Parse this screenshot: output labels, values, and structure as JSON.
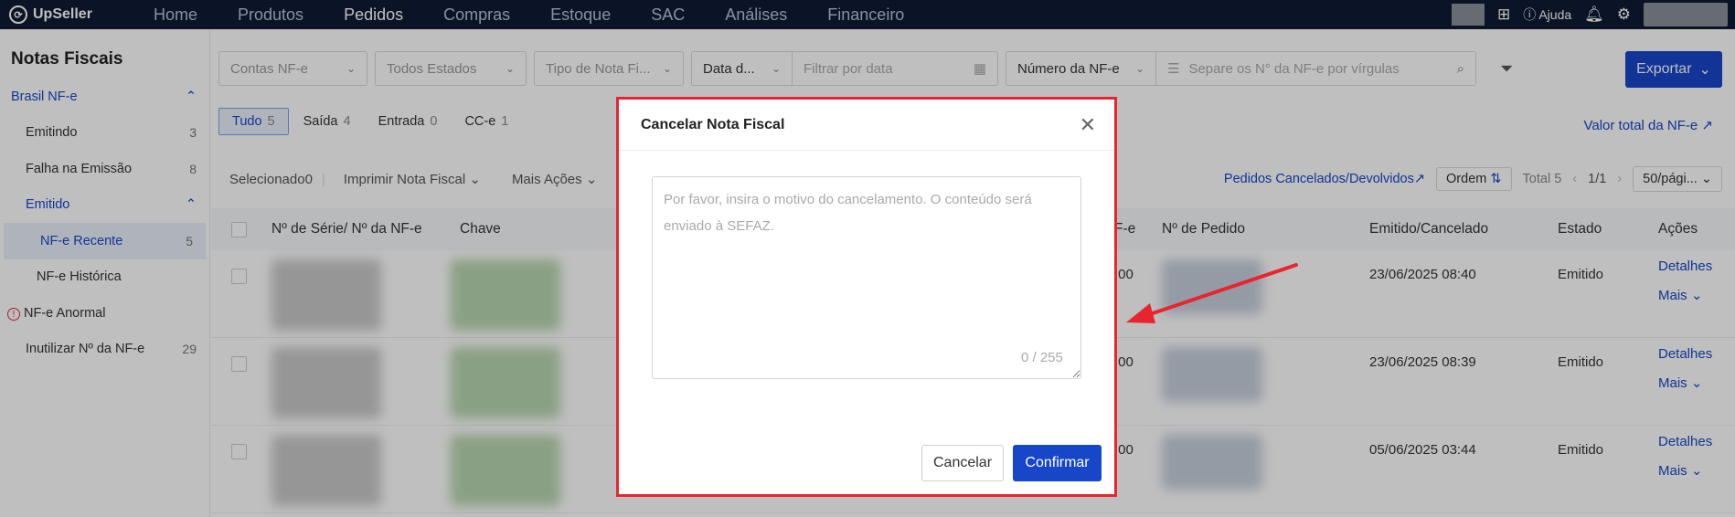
{
  "brand": {
    "name": "UpSeller"
  },
  "nav": [
    "Home",
    "Produtos",
    "Pedidos",
    "Compras",
    "Estoque",
    "SAC",
    "Análises",
    "Financeiro"
  ],
  "nav_active": "Pedidos",
  "top_right": {
    "help": "Ajuda"
  },
  "sidebar": {
    "title": "Notas Fiscais",
    "group": "Brasil NF-e",
    "items": [
      {
        "label": "Emitindo",
        "count": "3"
      },
      {
        "label": "Falha na Emissão",
        "count": "8"
      }
    ],
    "emitido": "Emitido",
    "emitido_children": [
      {
        "label": "NF-e Recente",
        "count": "5"
      },
      {
        "label": "NF-e Histórica",
        "count": ""
      }
    ],
    "abnormal": "NF-e Anormal",
    "inutilizar": {
      "label": "Inutilizar Nº da NF-e",
      "count": "29"
    }
  },
  "filters": {
    "contas": "Contas NF-e",
    "estados": "Todos Estados",
    "tipo": "Tipo de Nota Fi...",
    "data_sel": "Data d...",
    "data_placeholder": "Filtrar por data",
    "numero_sel": "Número da NF-e",
    "numero_placeholder": "Separe os N° da NF-e por vírgulas"
  },
  "export_label": "Exportar",
  "tabs": [
    {
      "label": "Tudo",
      "count": "5"
    },
    {
      "label": "Saída",
      "count": "4"
    },
    {
      "label": "Entrada",
      "count": "0"
    },
    {
      "label": "CC-e",
      "count": "1"
    }
  ],
  "valor_total": "Valor total da NF-e",
  "toolbar": {
    "selecionado": "Selecionado",
    "selecionado_count": "0",
    "imprimir": "Imprimir Nota Fiscal",
    "mais_acoes": "Mais Ações",
    "cancelados": "Pedidos Cancelados/Devolvidos",
    "ordem": "Ordem",
    "total": "Total 5",
    "page": "1/1",
    "per_page": "50/pági..."
  },
  "table": {
    "headers": {
      "serie": "Nº de Série/ Nº da NF-e",
      "chave": "Chave",
      "valor_partial": "F-e",
      "pedido": "Nº de Pedido",
      "emitido": "Emitido/Cancelado",
      "estado": "Estado",
      "acoes": "Ações"
    },
    "rows": [
      {
        "valor_partial": ",00",
        "date": "23/06/2025 08:40",
        "estado": "Emitido",
        "detalhes": "Detalhes",
        "mais": "Mais"
      },
      {
        "valor_partial": ",00",
        "date": "23/06/2025 08:39",
        "estado": "Emitido",
        "detalhes": "Detalhes",
        "mais": "Mais"
      },
      {
        "valor_partial": ",00",
        "date": "05/06/2025 03:44",
        "estado": "Emitido",
        "detalhes": "Detalhes",
        "mais": "Mais"
      }
    ]
  },
  "modal": {
    "title": "Cancelar Nota Fiscal",
    "placeholder": "Por favor, insira o motivo do cancelamento. O conteúdo será enviado à SEFAZ.",
    "counter": "0 / 255",
    "cancel": "Cancelar",
    "confirm": "Confirmar"
  },
  "colors": {
    "primary": "#1746c8",
    "nav_bg": "#0f1b35",
    "highlight": "#e8252f"
  }
}
